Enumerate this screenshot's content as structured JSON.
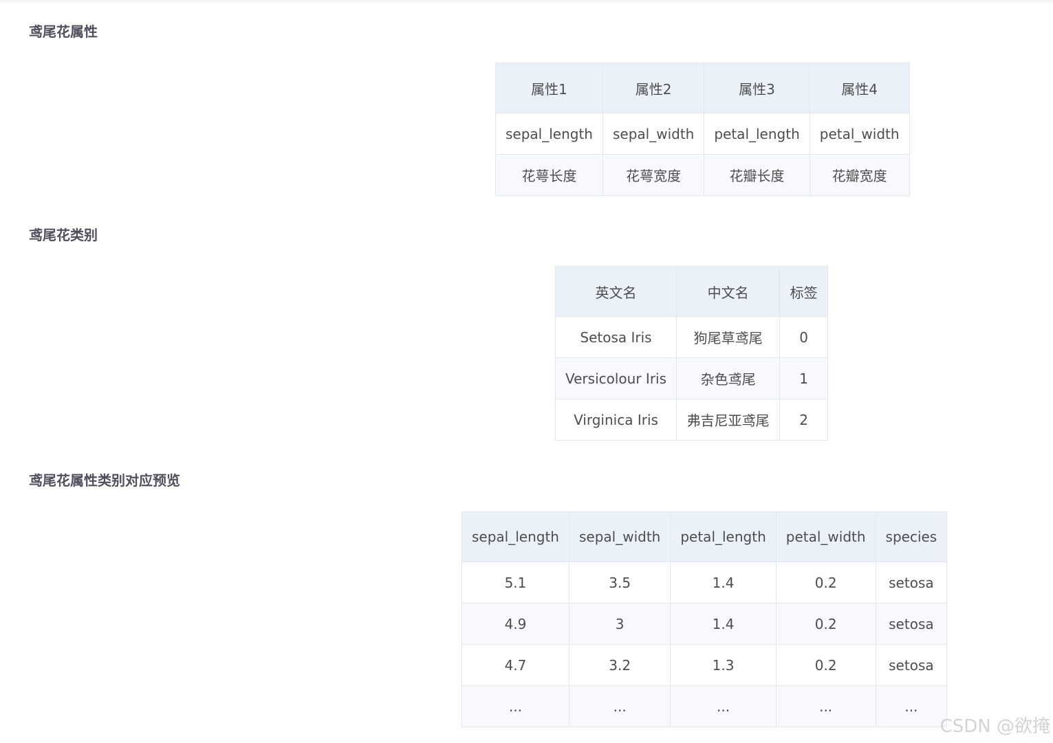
{
  "sections": {
    "attributes": {
      "title": "鸢尾花属性",
      "headers": [
        "属性1",
        "属性2",
        "属性3",
        "属性4"
      ],
      "rows": [
        [
          "sepal_length",
          "sepal_width",
          "petal_length",
          "petal_width"
        ],
        [
          "花萼长度",
          "花萼宽度",
          "花瓣长度",
          "花瓣宽度"
        ]
      ]
    },
    "classes": {
      "title": "鸢尾花类别",
      "headers": [
        "英文名",
        "中文名",
        "标签"
      ],
      "rows": [
        [
          "Setosa Iris",
          "狗尾草鸢尾",
          "0"
        ],
        [
          "Versicolour Iris",
          "杂色鸢尾",
          "1"
        ],
        [
          "Virginica Iris",
          "弗吉尼亚鸢尾",
          "2"
        ]
      ]
    },
    "preview": {
      "title": "鸢尾花属性类别对应预览",
      "headers": [
        "sepal_length",
        "sepal_width",
        "petal_length",
        "petal_width",
        "species"
      ],
      "rows": [
        [
          "5.1",
          "3.5",
          "1.4",
          "0.2",
          "setosa"
        ],
        [
          "4.9",
          "3",
          "1.4",
          "0.2",
          "setosa"
        ],
        [
          "4.7",
          "3.2",
          "1.3",
          "0.2",
          "setosa"
        ],
        [
          "...",
          "...",
          "...",
          "...",
          "..."
        ]
      ]
    }
  },
  "watermark": "CSDN @欲掩"
}
